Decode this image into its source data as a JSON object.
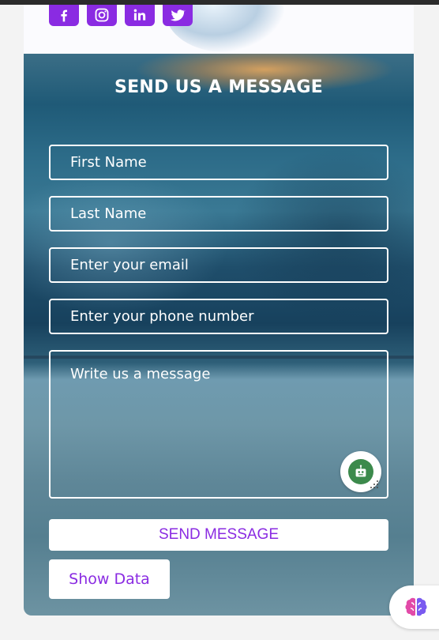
{
  "social": [
    {
      "name": "facebook"
    },
    {
      "name": "instagram"
    },
    {
      "name": "linkedin"
    },
    {
      "name": "twitter"
    }
  ],
  "form": {
    "title": "SEND US A MESSAGE",
    "first_name_placeholder": "First Name",
    "last_name_placeholder": "Last Name",
    "email_placeholder": "Enter your email",
    "phone_placeholder": "Enter your phone number",
    "message_placeholder": "Write us a message",
    "send_label": "SEND MESSAGE",
    "show_label": "Show Data"
  },
  "colors": {
    "accent": "#8a2be2",
    "text_on_image": "#ffffff",
    "button_bg": "#ffffff"
  },
  "icons": {
    "assistant": "robot-icon",
    "extension": "brain-icon"
  }
}
